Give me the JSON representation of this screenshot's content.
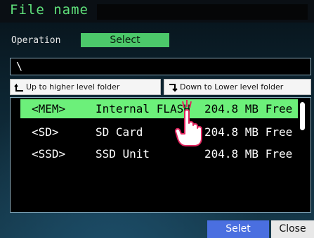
{
  "header": {
    "title": "File name"
  },
  "operation": {
    "label": "Operation",
    "value": "Select"
  },
  "path": {
    "current": "\\"
  },
  "nav": {
    "up_label": "Up to higher level folder",
    "down_label": "Down to Lower level folder",
    "up_icon": "folder-up-icon",
    "down_icon": "folder-down-icon"
  },
  "list": {
    "selected_index": 0,
    "rows": [
      {
        "drive": "<MEM>",
        "name": "Internal FLASH",
        "free": "204.8 MB Free"
      },
      {
        "drive": "<SD>",
        "name": "SD Card",
        "free": "204.8 MB Free"
      },
      {
        "drive": "<SSD>",
        "name": "SSD Unit",
        "free": "204.8 MB Free"
      }
    ]
  },
  "footer": {
    "select_label": "Selet",
    "close_label": "Close"
  },
  "colors": {
    "title_green": "#5fe07a",
    "selection_green": "#6cf07a",
    "operation_green": "#4cc86a",
    "select_blue": "#4a6fe0"
  }
}
